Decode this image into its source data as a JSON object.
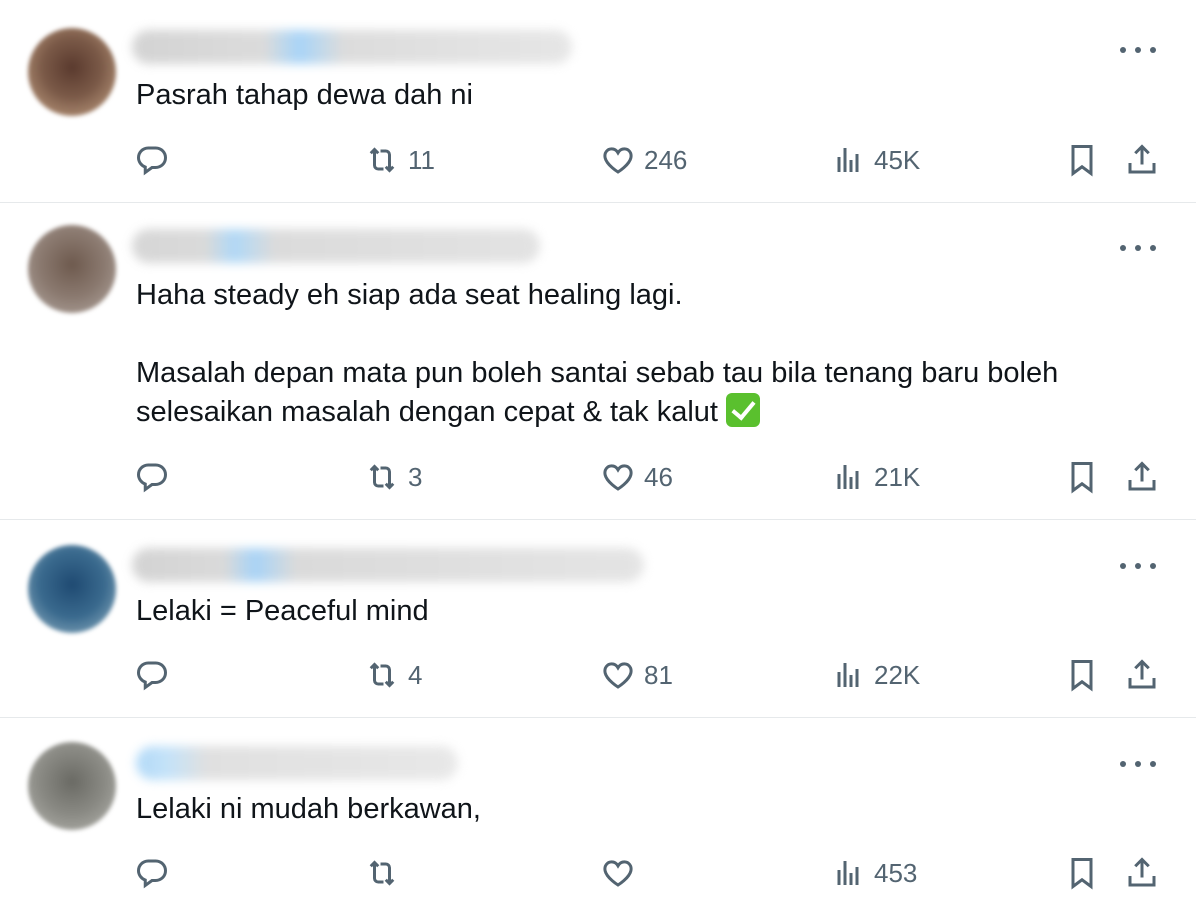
{
  "tweets": [
    {
      "text": "Pasrah tahap dewa dah ni",
      "retweets": "11",
      "likes": "246",
      "views": "45K",
      "avatar_color": "#6b4a3a"
    },
    {
      "text": "Haha steady eh siap ada seat healing lagi.\n\nMasalah depan mata pun boleh santai sebab tau bila tenang baru boleh selesaikan masalah dengan cepat & tak kalut",
      "has_check_emoji": true,
      "retweets": "3",
      "likes": "46",
      "views": "21K",
      "avatar_color": "#7a6a60"
    },
    {
      "text": "Lelaki = Peaceful mind",
      "retweets": "4",
      "likes": "81",
      "views": "22K",
      "avatar_color": "#2f5a7a"
    },
    {
      "text": "Lelaki ni mudah berkawan,",
      "retweets": "",
      "likes": "",
      "views": "453",
      "avatar_color": "#7d7d78"
    }
  ],
  "icons": {
    "reply": "reply-icon",
    "retweet": "retweet-icon",
    "like": "heart-icon",
    "views": "views-chart-icon",
    "bookmark": "bookmark-icon",
    "share": "share-icon",
    "more": "more-dots-icon"
  },
  "colors": {
    "icon_gray": "#536471",
    "text": "#0f1419",
    "divider": "#e6e9eb",
    "check_green": "#5ac02e"
  }
}
